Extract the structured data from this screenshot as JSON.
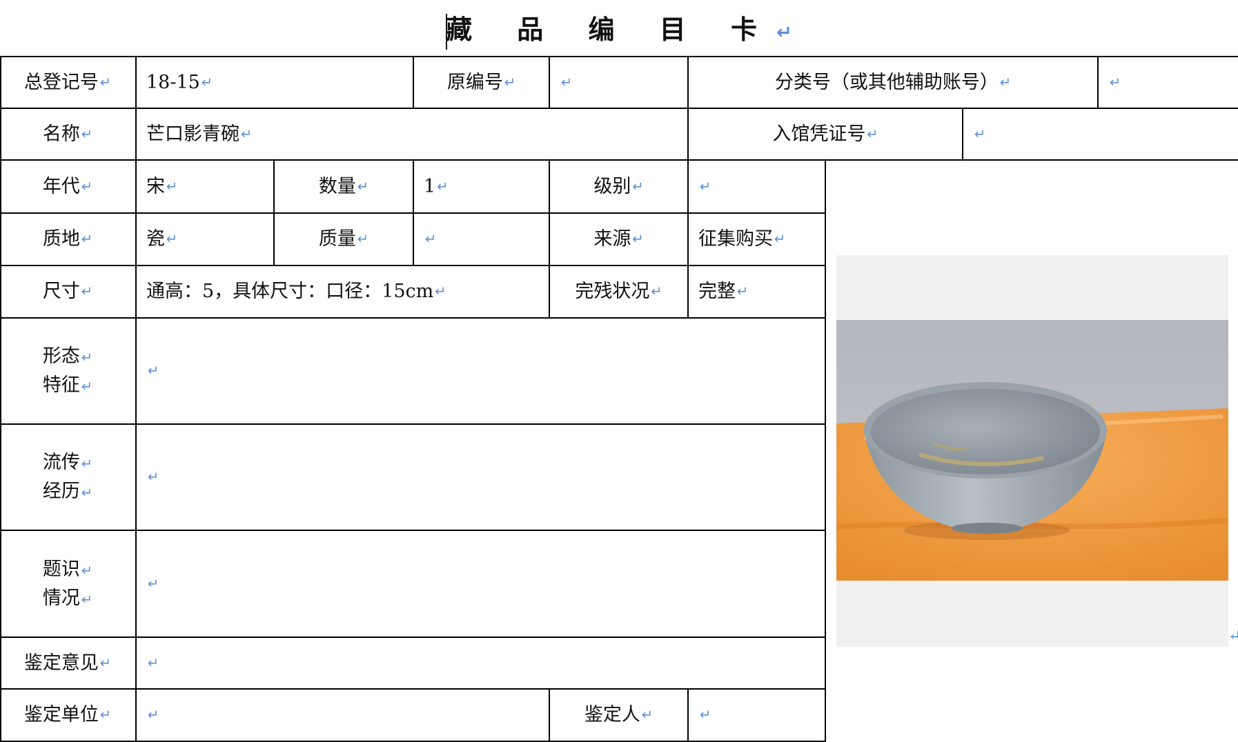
{
  "title": "藏 品 编 目 卡",
  "return_mark": "↵",
  "row1": {
    "reg_label": "总登记号",
    "reg_value": "18-15",
    "orig_label": "原编号",
    "orig_value": "",
    "class_label": "分类号（或其他辅助账号）",
    "class_value": ""
  },
  "row2": {
    "name_label": "名称",
    "name_value": "芒口影青碗",
    "voucher_label": "入馆凭证号",
    "voucher_value": ""
  },
  "row3": {
    "era_label": "年代",
    "era_value": "宋",
    "qty_label": "数量",
    "qty_value": "1",
    "grade_label": "级别",
    "grade_value": ""
  },
  "row4": {
    "material_label": "质地",
    "material_value": "瓷",
    "weight_label": "质量",
    "weight_value": "",
    "source_label": "来源",
    "source_value": "征集购买"
  },
  "row5": {
    "size_label": "尺寸",
    "size_value": "通高：5，具体尺寸：口径：15cm",
    "condition_label": "完残状况",
    "condition_value": "完整"
  },
  "features": {
    "label_1": "形态",
    "label_2": "特征",
    "value": ""
  },
  "history": {
    "label_1": "流传",
    "label_2": "经历",
    "value": ""
  },
  "inscription": {
    "label_1": "题识",
    "label_2": "情况",
    "value": ""
  },
  "appraisal": {
    "label": "鉴定意见",
    "value": ""
  },
  "unit": {
    "label": "鉴定单位",
    "value": "",
    "person_label": "鉴定人",
    "person_value": ""
  },
  "photo": {
    "subject": "celadon-bowl-photo",
    "background_color": "#f0a24a",
    "wall_color": "#b9bcc2",
    "bowl_color": "#a9b3bb"
  }
}
